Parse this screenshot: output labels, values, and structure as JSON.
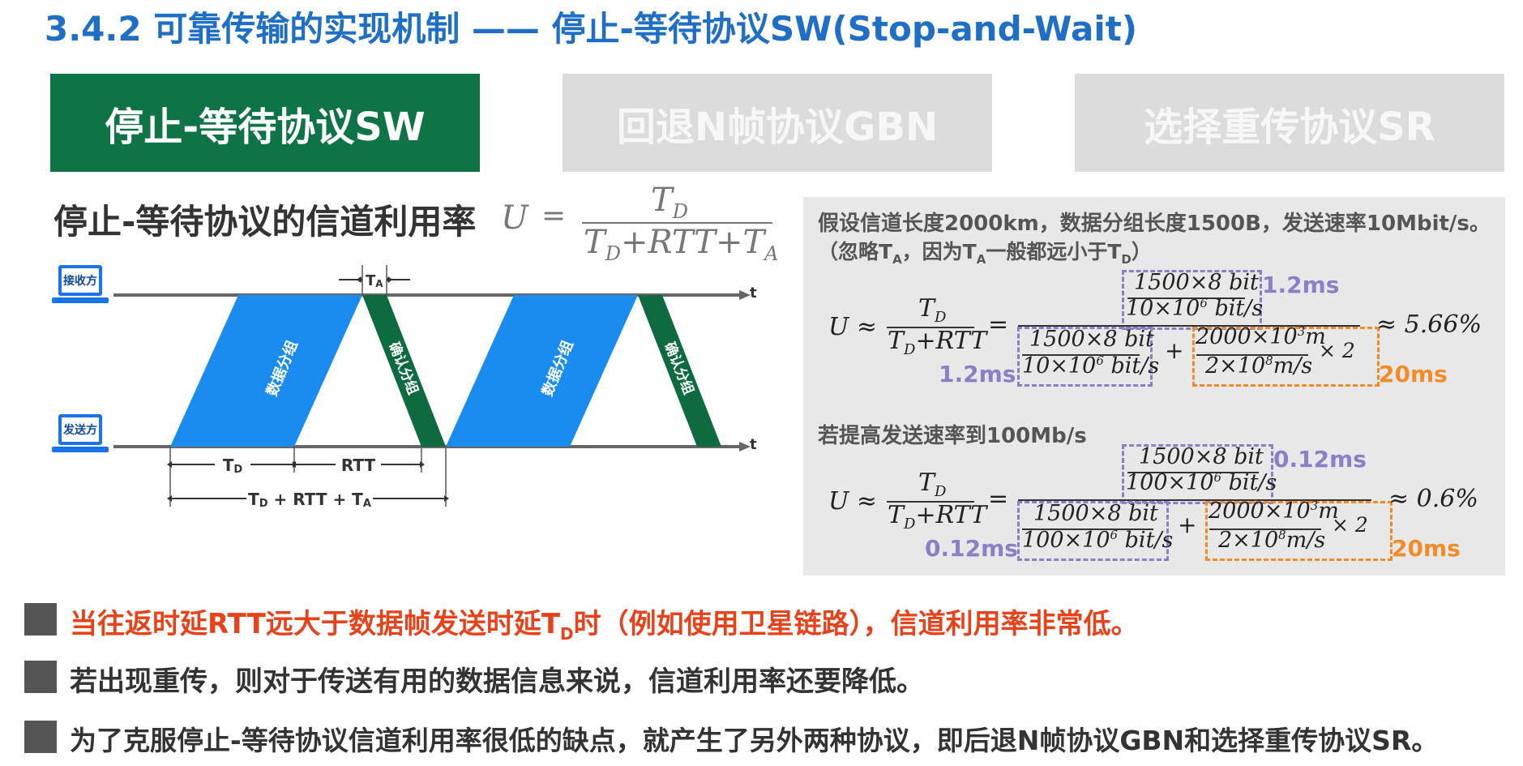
{
  "header": {
    "title": "3.4.2 可靠传输的实现机制 —— 停止-等待协议SW(Stop-and-Wait)"
  },
  "tabs": [
    {
      "label": "停止-等待协议SW",
      "active": true
    },
    {
      "label": "回退N帧协议GBN",
      "active": false
    },
    {
      "label": "选择重传协议SR",
      "active": false
    }
  ],
  "utilization": {
    "heading": "停止-等待协议的信道利用率",
    "lhs": "U",
    "eq": "=",
    "numerator": "T",
    "numerator_sub": "D",
    "denominator": "T",
    "denominator_sub": "D",
    "denominator_rest": "+RTT+T",
    "denominator_sub2": "A"
  },
  "diagram": {
    "receiver_label": "接收方",
    "sender_label": "发送方",
    "t_axis": "t",
    "ta_label": "T",
    "ta_sub": "A",
    "data_packet_label": "数据分组",
    "ack_packet_label": "确认分组",
    "td_label": "T",
    "td_sub": "D",
    "rtt_label": "RTT",
    "total_label": "T",
    "total_sub1": "D",
    "total_mid": " + RTT + T",
    "total_sub2": "A",
    "colors": {
      "data": "#1a8cf0",
      "ack": "#0e6b40",
      "line": "#666666"
    }
  },
  "panel": {
    "assumption": "假设信道长度2000km，数据分组长度1500B，发送速率10Mbit/s。",
    "note_open": "（忽略T",
    "note_sub1": "A",
    "note_mid": "，因为T",
    "note_sub2": "A",
    "note_mid2": "一般都远小于T",
    "note_sub3": "D",
    "note_close": "）",
    "case1": {
      "lhs": "U ≈",
      "ratio_num": "T",
      "ratio_num_sub": "D",
      "ratio_den": "T",
      "ratio_den_sub": "D",
      "ratio_den_rest": "+RTT",
      "eq": "=",
      "top_num": "1500×8  bit",
      "top_den": "10×10",
      "top_den_exp": "6",
      "top_den_unit": "  bit/s",
      "top_label": "1.2ms",
      "bot_num": "1500×8  bit",
      "bot_den": "10×10",
      "bot_den_exp": "6",
      "bot_den_unit": "  bit/s",
      "bot_label": "1.2ms",
      "plus": "+",
      "prop_num": "2000×10",
      "prop_num_exp": "3",
      "prop_num_unit": "m",
      "prop_den": "2×10",
      "prop_den_exp": "8",
      "prop_den_unit": "m/s",
      "times2": "×  2",
      "prop_label": "20ms",
      "result": "≈  5.66%"
    },
    "raise_text": "若提高发送速率到100Mb/s",
    "case2": {
      "lhs": "U ≈",
      "ratio_num": "T",
      "ratio_num_sub": "D",
      "ratio_den": "T",
      "ratio_den_sub": "D",
      "ratio_den_rest": "+RTT",
      "eq": "=",
      "top_num": "1500×8  bit",
      "top_den": "100×10",
      "top_den_exp": "6",
      "top_den_unit": "  bit/s",
      "top_label": "0.12ms",
      "bot_num": "1500×8  bit",
      "bot_den": "100×10",
      "bot_den_exp": "6",
      "bot_den_unit": "  bit/s",
      "bot_label": "0.12ms",
      "plus": "+",
      "prop_num": "2000×10",
      "prop_num_exp": "3",
      "prop_num_unit": "m",
      "prop_den": "2×10",
      "prop_den_exp": "8",
      "prop_den_unit": "m/s",
      "times2": "×  2",
      "prop_label": "20ms",
      "result": "≈  0.6%"
    }
  },
  "bullets": [
    {
      "pre": "当往返时延RTT远大于数据帧发送时延T",
      "sub": "D",
      "post": "时（例如使用卫星链路），信道利用率非常低。",
      "color": "#e8421b"
    },
    {
      "pre": "若出现重传，则对于传送有用的数据信息来说，信道利用率还要降低。",
      "sub": "",
      "post": "",
      "color": "#333333"
    },
    {
      "pre": "为了克服停止-等待协议信道利用率很低的缺点，就产生了另外两种协议，即后退N帧协议GBN和选择重传协议SR。",
      "sub": "",
      "post": "",
      "color": "#333333"
    }
  ]
}
